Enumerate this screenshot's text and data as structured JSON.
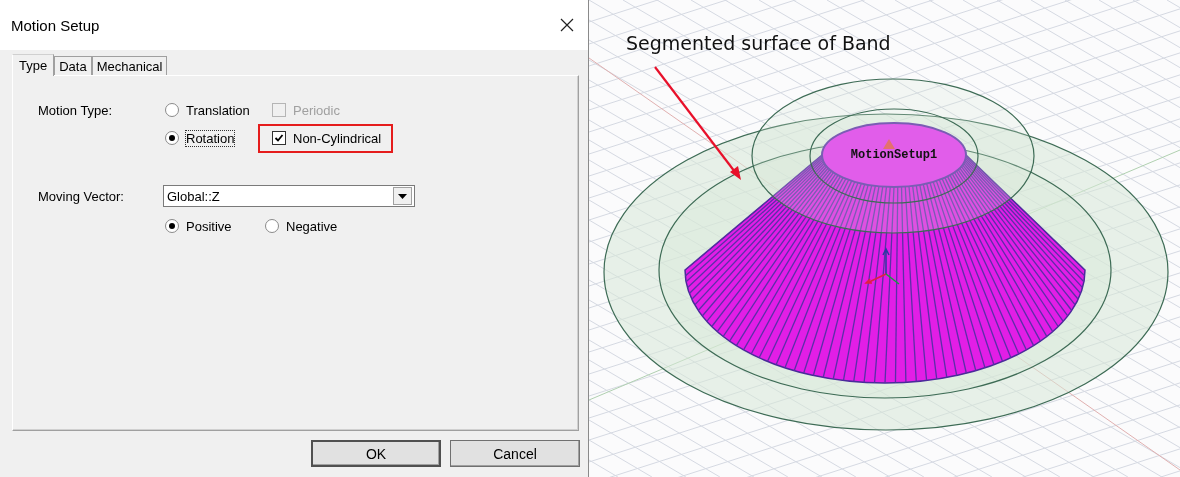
{
  "window": {
    "title": "Motion Setup"
  },
  "tabs": [
    {
      "label": "Type",
      "selected": true
    },
    {
      "label": "Data",
      "selected": false
    },
    {
      "label": "Mechanical",
      "selected": false
    }
  ],
  "motion_type": {
    "label": "Motion Type:",
    "options": [
      {
        "label": "Translation",
        "selected": false,
        "focused": false
      },
      {
        "label": "Rotation",
        "selected": true,
        "focused": true
      }
    ]
  },
  "checkboxes": [
    {
      "label": "Periodic",
      "checked": false,
      "disabled": true,
      "highlighted": false
    },
    {
      "label": "Non-Cylindrical",
      "checked": true,
      "disabled": false,
      "highlighted": true
    }
  ],
  "moving_vector": {
    "label": "Moving Vector:",
    "value": "Global::Z",
    "direction": [
      {
        "label": "Positive",
        "selected": true
      },
      {
        "label": "Negative",
        "selected": false
      }
    ]
  },
  "buttons": [
    "OK",
    "Cancel"
  ],
  "viewport": {
    "annotation": "Segmented surface of Band",
    "object_label": "MotionSetup1"
  }
}
